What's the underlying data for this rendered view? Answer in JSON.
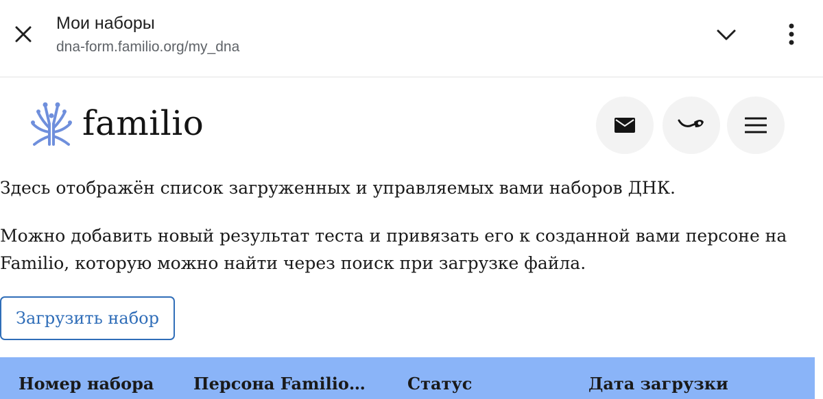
{
  "browser": {
    "title": "Мои наборы",
    "url": "dna-form.familio.org/my_dna",
    "icons": {
      "close": "close-icon",
      "collapse": "chevron-down-icon",
      "more": "more-vertical-icon"
    }
  },
  "header": {
    "logo_text": "familio",
    "logo_color": "#6f8fdc",
    "buttons": [
      {
        "icon": "envelope-icon"
      },
      {
        "icon": "horn-icon"
      },
      {
        "icon": "menu-icon"
      }
    ]
  },
  "content": {
    "intro": "Здесь отображён список загруженных и управляемых вами наборов ДНК.",
    "hint": "Можно добавить новый результат теста и привязать его к созданной вами персоне на Familio, которую можно найти через поиск при загрузке файла.",
    "upload_label": "Загрузить набор",
    "accent_color": "#2f6db8"
  },
  "table": {
    "header_color": "#8ab4f8",
    "columns": [
      "Номер набора",
      "Персона Familio…",
      "Статус",
      "Дата загрузки"
    ]
  }
}
